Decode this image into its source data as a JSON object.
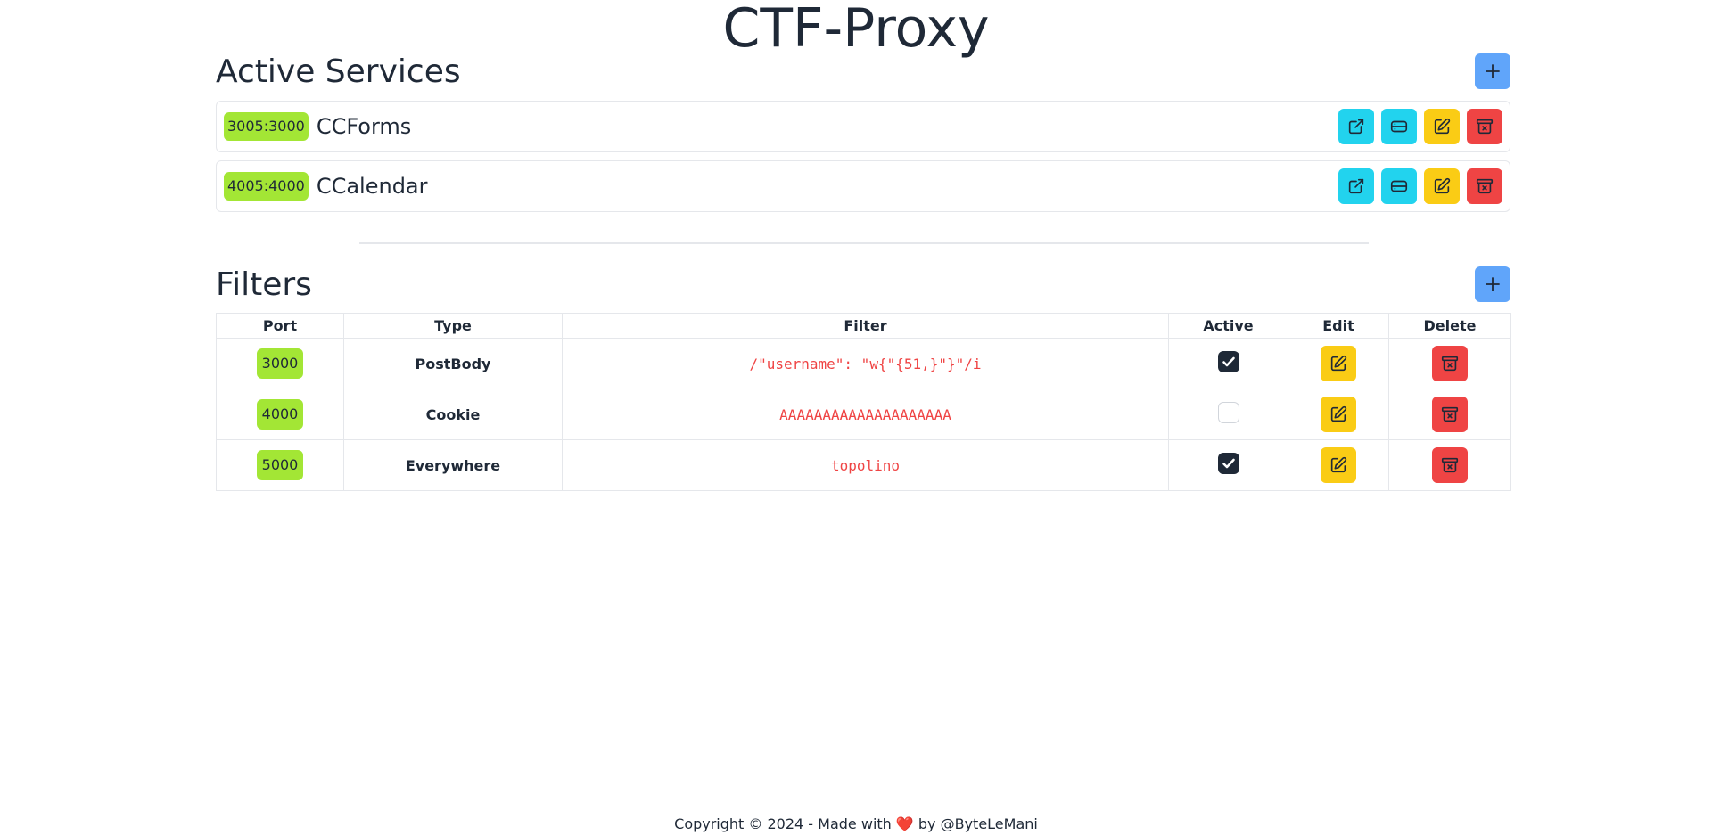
{
  "app": {
    "title": "CTF-Proxy"
  },
  "services_section": {
    "heading": "Active Services",
    "add_icon": "plus-icon",
    "items": [
      {
        "ports": "3005:3000",
        "name": "CCForms"
      },
      {
        "ports": "4005:4000",
        "name": "CCalendar"
      }
    ],
    "action_icons": [
      "external-link-icon",
      "database-icon",
      "edit-icon",
      "archive-delete-icon"
    ]
  },
  "filters_section": {
    "heading": "Filters",
    "add_icon": "plus-icon",
    "columns": [
      "Port",
      "Type",
      "Filter",
      "Active",
      "Edit",
      "Delete"
    ],
    "rows": [
      {
        "port": "3000",
        "type": "PostBody",
        "filter": "/\"username\": \"w{\"{51,}\"}\"/i",
        "active": true
      },
      {
        "port": "4000",
        "type": "Cookie",
        "filter": "AAAAAAAAAAAAAAAAAAAA",
        "active": false
      },
      {
        "port": "5000",
        "type": "Everywhere",
        "filter": "topolino",
        "active": true
      }
    ]
  },
  "footer": {
    "prefix": "Copyright © 2024 - Made with ",
    "heart": "❤️",
    "suffix": " by @ByteLeMani"
  },
  "colors": {
    "primary": "#60a5fa",
    "port_badge": "#a3e635",
    "open": "#22d3ee",
    "edit": "#facc15",
    "delete": "#ef4444",
    "text": "#1f2937"
  }
}
